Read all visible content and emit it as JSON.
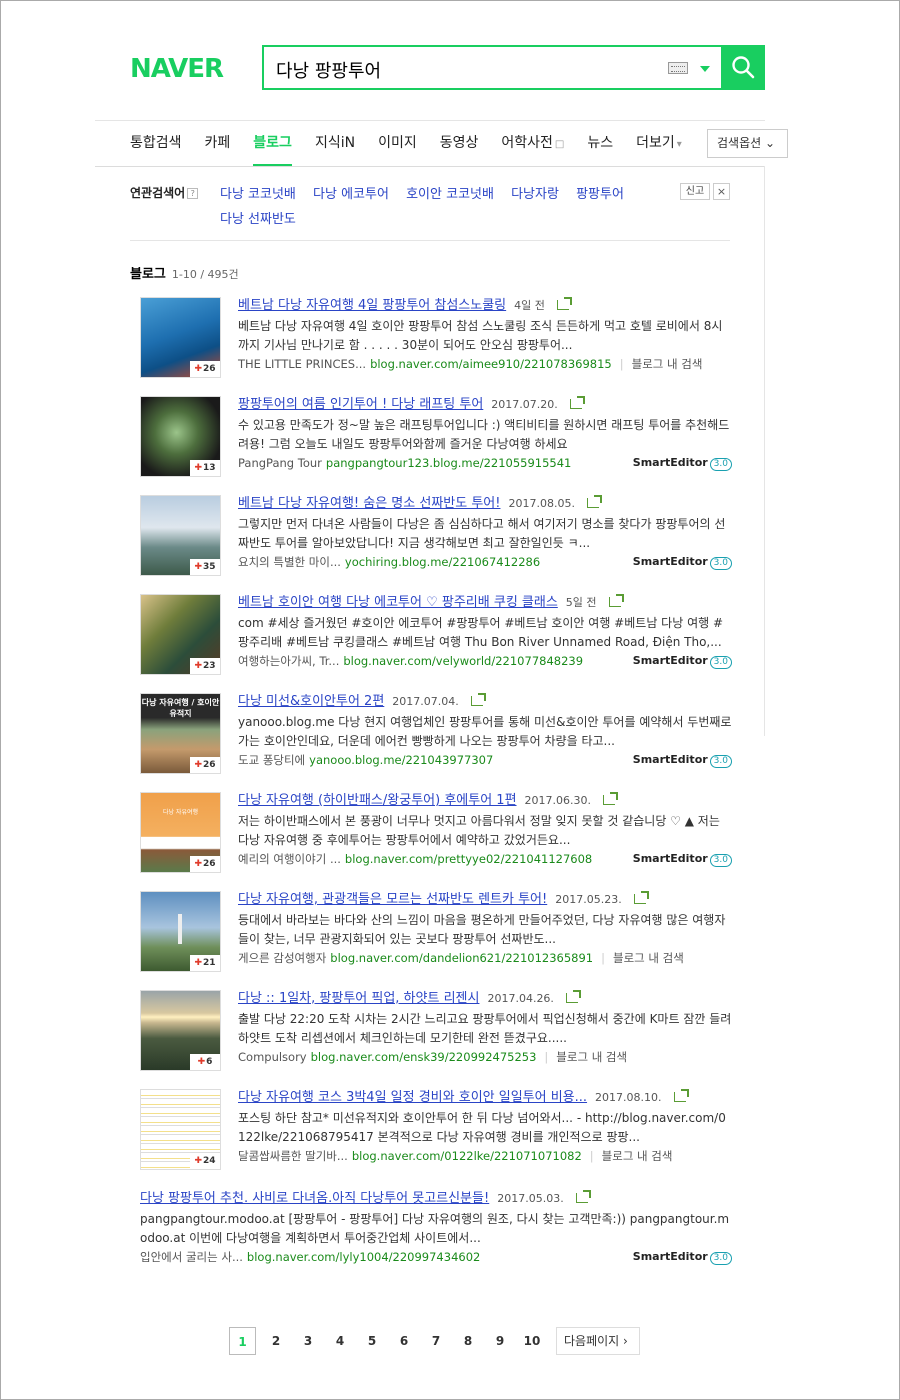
{
  "header": {
    "logo": "NAVER",
    "query": "다낭 팡팡투어"
  },
  "tabs": [
    {
      "label": "통합검색"
    },
    {
      "label": "카페"
    },
    {
      "label": "블로그",
      "active": true
    },
    {
      "label": "지식iN"
    },
    {
      "label": "이미지"
    },
    {
      "label": "동영상"
    },
    {
      "label": "어학사전"
    },
    {
      "label": "뉴스"
    },
    {
      "label": "더보기"
    }
  ],
  "search_option_label": "검색옵션",
  "related": {
    "label": "연관검색어",
    "help": "?",
    "items": [
      "다낭 코코넛배",
      "다낭 에코투어",
      "호이안 코코넛배",
      "다낭자랑",
      "팡팡투어",
      "다낭 선짜반도"
    ],
    "report_label": "신고",
    "close_label": "×"
  },
  "section": {
    "title": "블로그",
    "count": "1-10 / 495건"
  },
  "results": [
    {
      "title": "베트남 다낭 자유여행 4일 팡팡투어 참섬스노쿨링",
      "date": "4일 전",
      "desc": "베트남 다낭 자유여행 4일 호이안 팡팡투어 참섬 스노쿨링 조식 든든하게 먹고 호텔 로비에서 8시까지 기사님 만나기로 함 . . . . . 30분이 되어도 안오심 팡팡투어...",
      "source": "THE LITTLE PRINCES...",
      "url": "blog.naver.com/aimee910/221078369815",
      "extra": "블로그 내 검색",
      "badge": "26"
    },
    {
      "title": "팡팡투어의 여름 인기투어 ! 다낭 래프팅 투어",
      "date": "2017.07.20.",
      "desc": "수 있고용 만족도가 정~말 높은 래프팅투어입니다 :) 액티비티를 원하시면 래프팅 투어를 추천해드려용! 그럼 오늘도 내일도 팡팡투어와함께 즐거운 다낭여행 하세요",
      "source": "PangPang Tour",
      "url": "pangpangtour123.blog.me/221055915541",
      "extra": "SmartEditor",
      "extra_ver": "3.0",
      "badge": "13"
    },
    {
      "title": "베트남 다낭 자유여행! 숨은 명소 선짜반도 투어!",
      "date": "2017.08.05.",
      "desc": "그렇지만 먼저 다녀온 사람들이 다낭은 좀 심심하다고 해서 여기저기 명소를 찾다가 팡팡투어의 선짜반도 투어를 알아보았답니다! 지금 생각해보면 최고 잘한일인듯 ㅋ...",
      "source": "요치의 특별한 마이...",
      "url": "yochiring.blog.me/221067412286",
      "extra": "SmartEditor",
      "extra_ver": "3.0",
      "badge": "35"
    },
    {
      "title": "베트남 호이안 여행 다낭 에코투어 ♡ 팡주리배 쿠킹 클래스",
      "date": "5일 전",
      "desc": "com #세상 즐거웠던 #호이안 에코투어 #팡팡투어 #베트남 호이안 여행 #베트남 다낭 여행 #팡주리배 #베트남 쿠킹클래스 #베트남 여행 Thu Bon River Unnamed Road, Điện Tho,...",
      "source": "여행하는아가씨, Tr...",
      "url": "blog.naver.com/velyworld/221077848239",
      "extra": "SmartEditor",
      "extra_ver": "3.0",
      "badge": "23"
    },
    {
      "title": "다낭 미선&호이안투어 2편",
      "date": "2017.07.04.",
      "desc": "yanooo.blog.me 다낭 현지 여행업체인 팡팡투어를 통해 미선&호이안 투어를 예약해서 두번째로 가는 호이안인데요, 더운데 에어컨 빵빵하게 나오는 팡팡투어 차량을 타고...",
      "source": "도교 퐁당티에",
      "url": "yanooo.blog.me/221043977307",
      "extra": "SmartEditor",
      "extra_ver": "3.0",
      "badge": "26",
      "thumb_text": "다낭 자유여행 / 호이안 유적지"
    },
    {
      "title": "다낭 자유여행 (하이반패스/왕궁투어) 후에투어 1편",
      "date": "2017.06.30.",
      "desc": "저는 하이반패스에서 본 풍광이 너무나 멋지고 아름다워서 정말 잊지 못할 것 같습니당 ♡ ▲ 저는 다낭 자유여행 중 후에투어는 팡팡투어에서 예약하고 갔었거든요...",
      "source": "예리의 여행이야기 ...",
      "url": "blog.naver.com/prettyye02/221041127608",
      "extra": "SmartEditor",
      "extra_ver": "3.0",
      "badge": "26",
      "thumb_text": "다낭 자유여행"
    },
    {
      "title": "다낭 자유여행, 관광객들은 모르는 선짜반도 렌트카 투어!",
      "date": "2017.05.23.",
      "desc": "등대에서 바라보는 바다와 산의 느낌이 마음을 평온하게 만들어주었던, 다낭 자유여행 많은 여행자들이 찾는, 너무 관광지화되어 있는 곳보다 팡팡투어 선짜반도...",
      "source": "게으른 감성여행자",
      "url": "blog.naver.com/dandelion621/221012365891",
      "extra": "블로그 내 검색",
      "badge": "21"
    },
    {
      "title": "다낭 :: 1일차, 팡팡투어 픽업, 하얏트 리젠시",
      "date": "2017.04.26.",
      "desc": "출발 다낭 22:20 도착 시차는 2시간 느리고요 팡팡투어에서 픽업신청해서 중간에 K마트 잠깐 들려 하얏트 도착 리셉션에서 체크인하는데 모기한테 완전 뜯겼구요.....",
      "source": "Compulsory",
      "url": "blog.naver.com/ensk39/220992475253",
      "extra": "블로그 내 검색",
      "badge": "6"
    },
    {
      "title": "다낭 자유여행 코스 3박4일 일정 경비와 호이안 일일투어 비용...",
      "date": "2017.08.10.",
      "desc": "포스팅 하단 참고* 미선유적지와 호이안투어 한 뒤 다낭 넘어와서... - http://blog.naver.com/0122lke/221068795417 본격적으로 다낭 자유여행 경비를 개인적으로 팡팡...",
      "source": "달콤쌉싸름한 딸기바...",
      "url": "blog.naver.com/0122lke/221071071082",
      "extra": "블로그 내 검색",
      "badge": "24"
    },
    {
      "title": "다낭 팡팡투어 추천. 사비로 다녀옴.아직 다낭투어 못고르신분들!",
      "date": "2017.05.03.",
      "desc": "pangpangtour.modoo.at [팡팡투어 - 팡팡투어] 다낭 자유여행의 원조, 다시 찾는 고객만족:)) pangpangtour.modoo.at 이번에 다낭여행을 계획하면서 투어중간업체 사이트에서...",
      "source": "입안에서 굴리는 사...",
      "url": "blog.naver.com/lyly1004/220997434602",
      "extra": "SmartEditor",
      "extra_ver": "3.0"
    }
  ],
  "pagination": {
    "pages": [
      "1",
      "2",
      "3",
      "4",
      "5",
      "6",
      "7",
      "8",
      "9",
      "10"
    ],
    "current": "1",
    "next_label": "다음페이지 ›"
  },
  "colors": {
    "brand": "#19ce60",
    "link": "#2a44c6",
    "url": "#1a8a1a"
  }
}
